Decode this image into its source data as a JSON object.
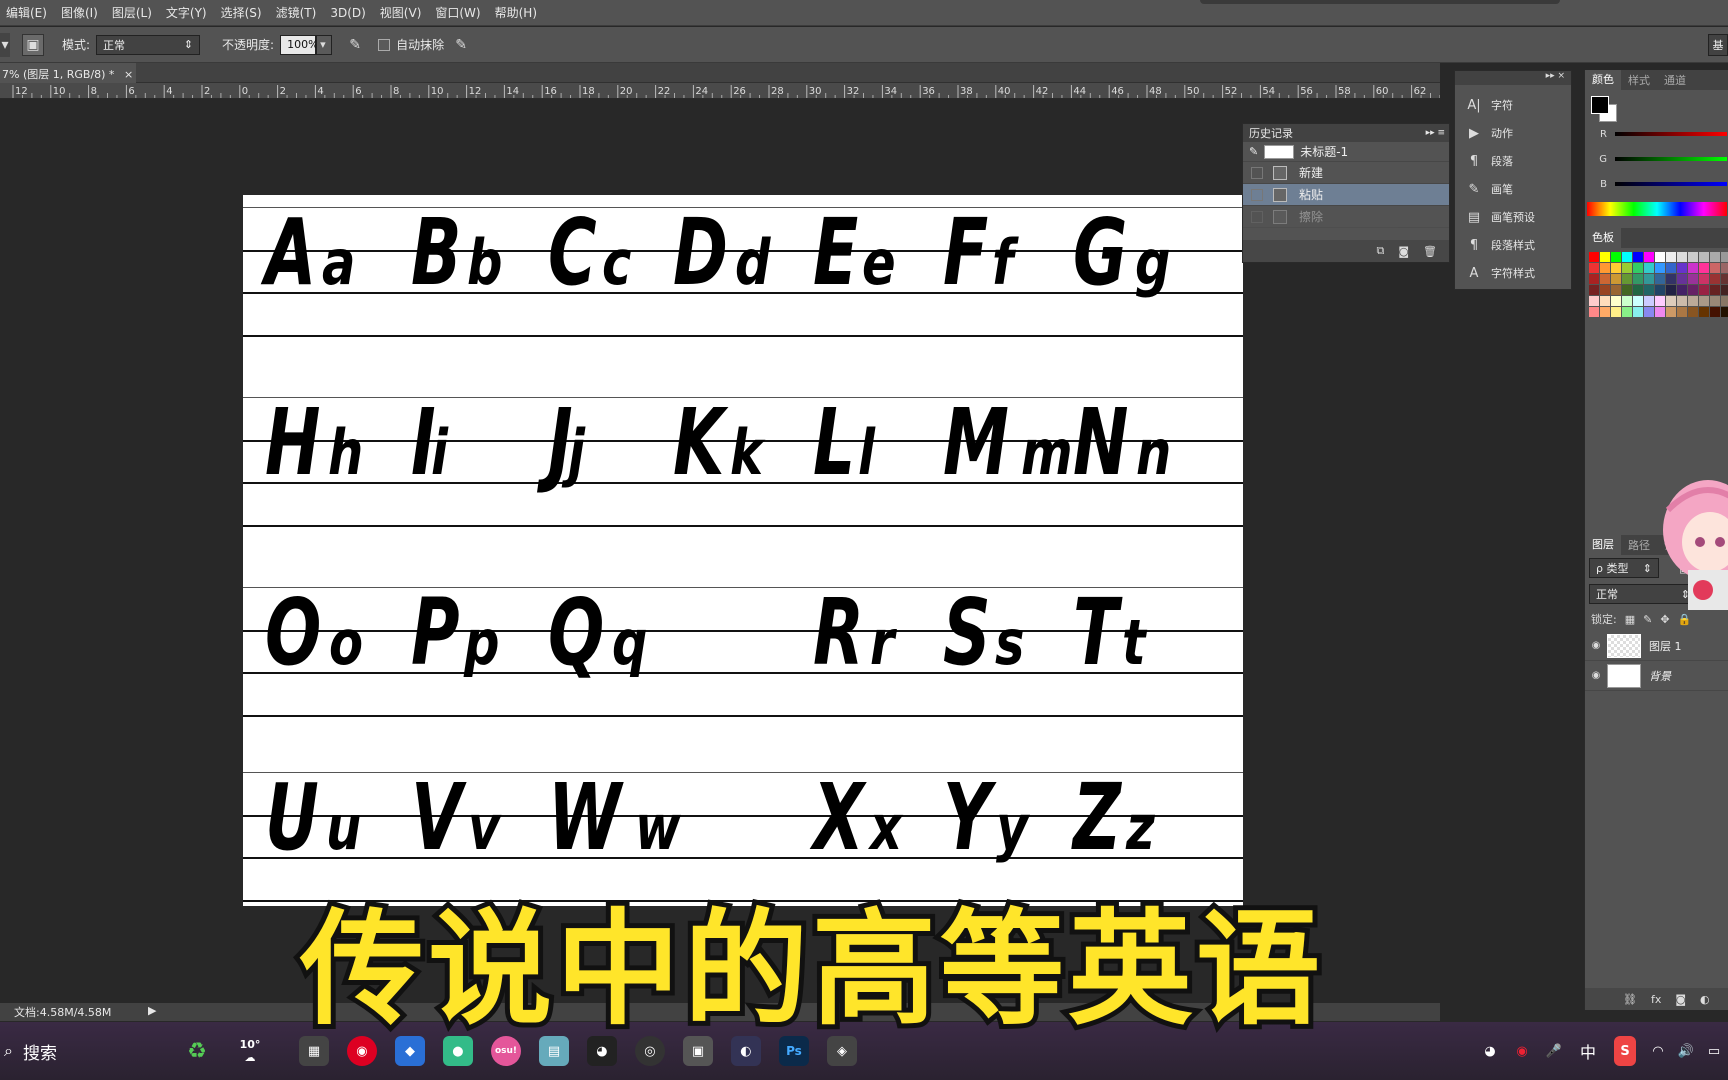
{
  "menu": [
    "编辑(E)",
    "图像(I)",
    "图层(L)",
    "文字(Y)",
    "选择(S)",
    "滤镜(T)",
    "3D(D)",
    "视图(V)",
    "窗口(W)",
    "帮助(H)"
  ],
  "options": {
    "mode_label": "模式:",
    "mode_value": "正常",
    "opacity_label": "不透明度:",
    "opacity_value": "100%",
    "auto_erase_label": "自动抹除",
    "right_button": "基"
  },
  "document_tab": "7% (图层 1, RGB/8) *",
  "ruler_labels": [
    "12",
    "10",
    "8",
    "6",
    "4",
    "2",
    "0",
    "2",
    "4",
    "6",
    "8",
    "10",
    "12",
    "14",
    "16",
    "18",
    "20",
    "22",
    "24",
    "26",
    "28",
    "30",
    "32",
    "34",
    "36",
    "38",
    "40",
    "42",
    "44",
    "46",
    "48",
    "50",
    "52",
    "54",
    "56",
    "58",
    "60",
    "62"
  ],
  "history": {
    "title": "历史记录",
    "snapshot": "未标题-1",
    "items": [
      "新建",
      "粘贴",
      "擦除"
    ],
    "selected": 1
  },
  "dock": [
    "字符",
    "动作",
    "段落",
    "画笔",
    "画笔预设",
    "段落样式",
    "字符样式"
  ],
  "color_panel": {
    "tabs": [
      "颜色",
      "样式",
      "通道"
    ],
    "channels": [
      "R",
      "G",
      "B"
    ]
  },
  "swatches_title": "色板",
  "layers_panel": {
    "tabs": [
      "图层",
      "路径",
      "调整"
    ],
    "filter_label": "ρ 类型",
    "blend": "正常",
    "opacity_short": "不透",
    "lock_label": "锁定:",
    "layers": [
      "图层 1",
      "背景"
    ]
  },
  "status": "文档:4.58M/4.58M",
  "taskbar": {
    "search": "搜索",
    "weather": "10°",
    "ime": "中",
    "osu": "osu!"
  },
  "caption": "传说中的高等英语",
  "letters": [
    [
      "Aa",
      "Bb",
      "Cc",
      "Dd",
      "Ee",
      "Ff",
      "Gg"
    ],
    [
      "Hh",
      "Ii",
      "Jj",
      "Kk",
      "Ll",
      "Mm",
      "Nn"
    ],
    [
      "Oo",
      "Pp",
      "Qq",
      "",
      "Rr",
      "Ss",
      "Tt"
    ],
    [
      "Uu",
      "Vv",
      "Ww",
      "",
      "Xx",
      "Yy",
      "Zz"
    ]
  ]
}
